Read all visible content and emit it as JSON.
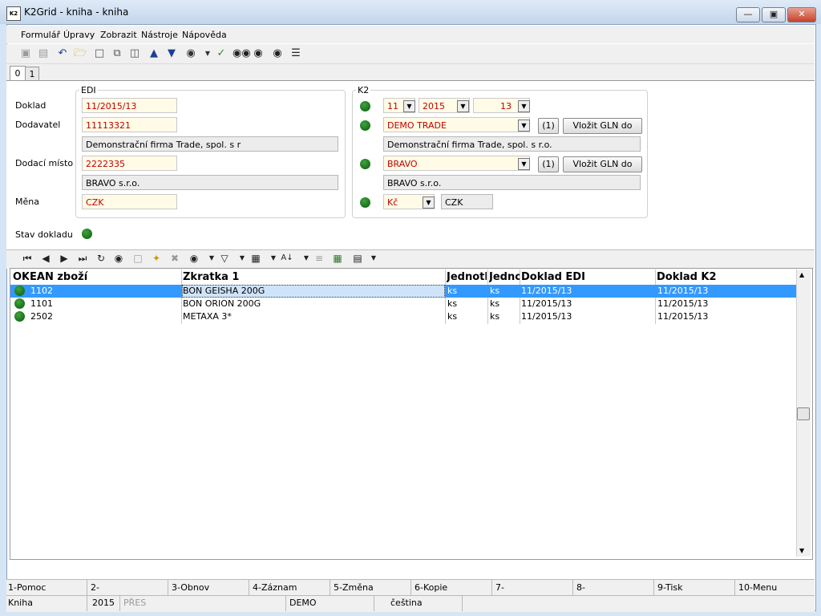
{
  "window": {
    "title": "K2Grid - kniha - kniha",
    "app_icon_text": "K2",
    "min_icon": "minimize-icon",
    "max_icon": "maximize-icon",
    "close_icon": "close-icon"
  },
  "menu": [
    "Formulář",
    "Úpravy",
    "Zobrazit",
    "Nástroje",
    "Nápověda"
  ],
  "toolbar_icons": [
    "save-icon",
    "save-as-icon",
    "undo-icon",
    "open-folder-icon",
    "new-document-icon",
    "copy-icon",
    "paste-icon",
    "arrow-up-icon",
    "arrow-down-icon",
    "camera-icon",
    "dropdown-icon",
    "filter-binoculars-icon",
    "binoculars-icon",
    "binoculars-next-icon",
    "binoculars-prev-icon",
    "menu-lines-icon"
  ],
  "tabs": [
    "0",
    "1"
  ],
  "edi": {
    "title": "EDI",
    "doklad_label": "Doklad",
    "doklad_value": "11/2015/13",
    "dodavatel_label": "Dodavatel",
    "dodavatel_value": "11113321",
    "dodavatel_name": "Demonstrační firma Trade, spol. s r",
    "dodaci_label": "Dodací místo",
    "dodaci_value": "2222335",
    "dodaci_name": "BRAVO s.r.o.",
    "mena_label": "Měna",
    "mena_value": "CZK"
  },
  "k2": {
    "title": "K2",
    "period_month": "11",
    "period_year": "2015",
    "book_number": "13",
    "dodavatel_value": "DEMO TRADE",
    "dodavatel_count": "(1)",
    "gln_button_1": "Vložit GLN do karty",
    "dodavatel_name": "Demonstrační firma Trade, spol. s r.o.",
    "dodaci_value": "BRAVO",
    "dodaci_count": "(1)",
    "gln_button_2": "Vložit GLN do karty",
    "dodaci_name": "BRAVO s.r.o.",
    "mena_value": "Kč",
    "mena_code": "CZK"
  },
  "stav": {
    "label": "Stav dokladu"
  },
  "grid_toolbar_icons": [
    "first-record-icon",
    "prev-record-icon",
    "next-record-icon",
    "last-record-icon",
    "refresh-icon",
    "binoculars-icon",
    "lock-icon",
    "add-star-icon",
    "remove-icon",
    "camera-icon",
    "filter-icon",
    "export-icon",
    "sort-az-icon",
    "list-icon",
    "excel-icon",
    "columns-icon"
  ],
  "grid": {
    "columns": [
      "OK",
      "EAN zboží",
      "Zkratka 1",
      "Jednotk",
      "Jedno",
      "Doklad EDI",
      "Doklad K2"
    ],
    "rows": [
      {
        "ean": "1102",
        "zkratka": "BON GEISHA 200G",
        "jednotka1": "ks",
        "jednotka2": "ks",
        "doklad_edi": "11/2015/13",
        "doklad_k2": "11/2015/13",
        "selected": true
      },
      {
        "ean": "1101",
        "zkratka": "BON ORION 200G",
        "jednotka1": "ks",
        "jednotka2": "ks",
        "doklad_edi": "11/2015/13",
        "doklad_k2": "11/2015/13",
        "selected": false
      },
      {
        "ean": "2502",
        "zkratka": "METAXA 3*",
        "jednotka1": "ks",
        "jednotka2": "ks",
        "doklad_edi": "11/2015/13",
        "doklad_k2": "11/2015/13",
        "selected": false
      }
    ]
  },
  "function_keys": [
    "1-Pomoc",
    "2-",
    "3-Obnov",
    "4-Záznam",
    "5-Změna",
    "6-Kopie",
    "7-",
    "8-",
    "9-Tisk",
    "10-Menu"
  ],
  "status": {
    "module": "Kniha",
    "year": "2015",
    "mode": "PŘES",
    "company": "DEMO",
    "language": "čeština"
  },
  "colors": {
    "selection": "#3399ff",
    "accent_red": "#c00000",
    "led_green": "#1b7a1b"
  }
}
